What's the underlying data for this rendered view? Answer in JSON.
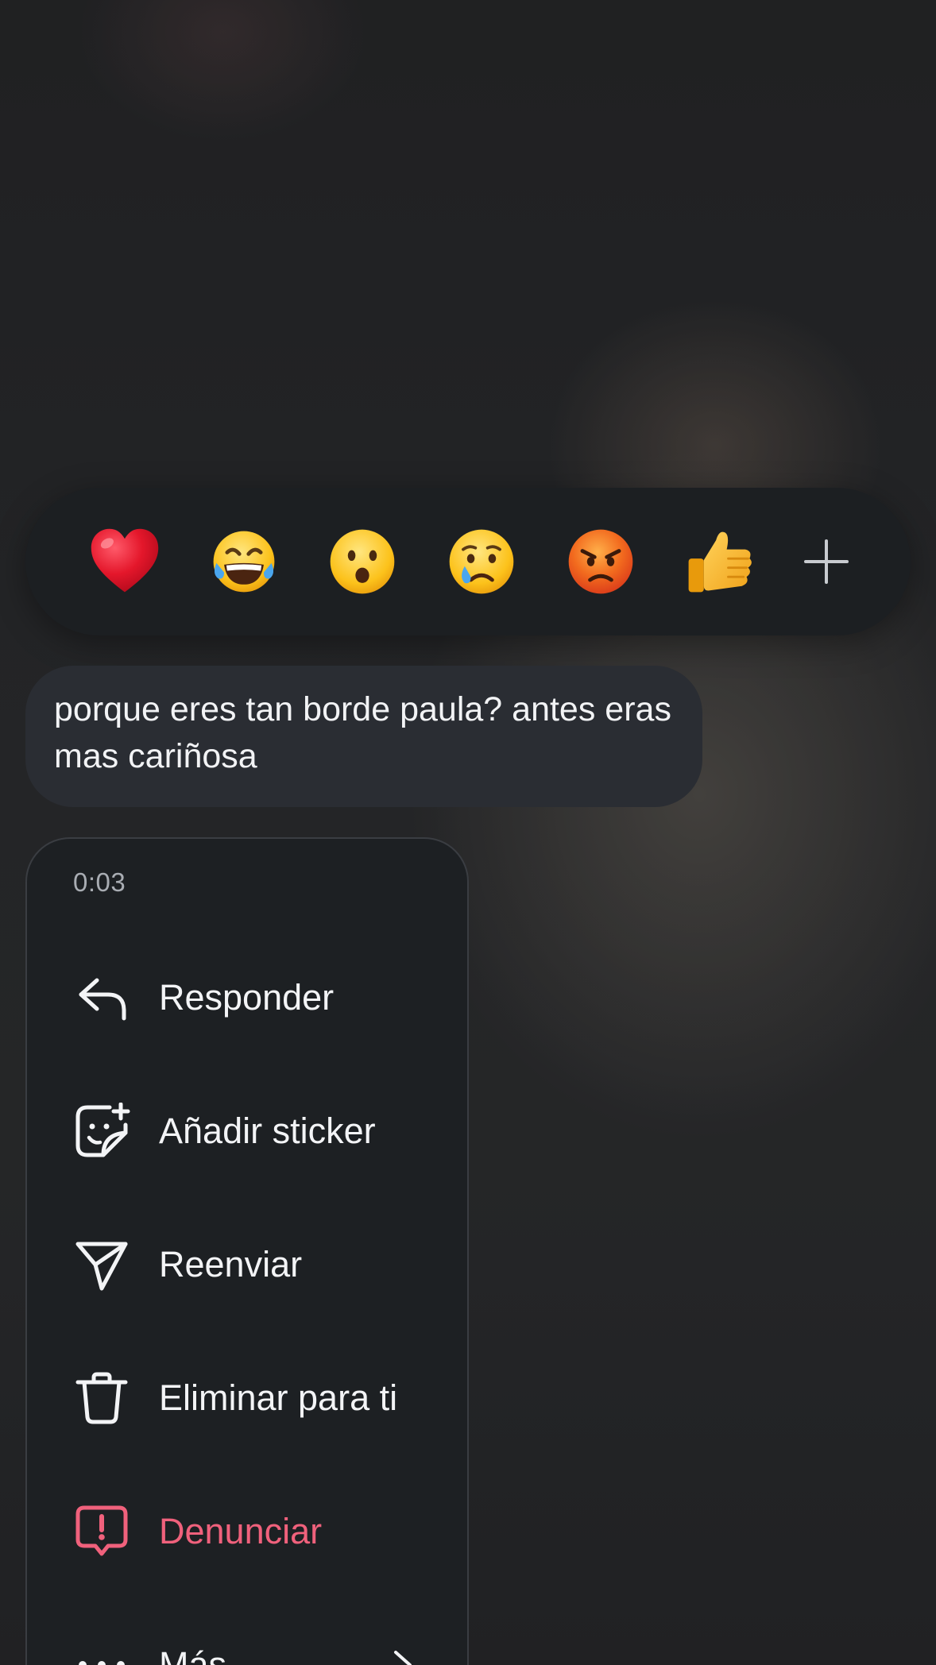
{
  "reactions": {
    "emojis": [
      "red-heart",
      "tears-of-joy",
      "hushed-face",
      "crying-face",
      "angry-face",
      "thumbs-up"
    ],
    "more_icon": "plus-icon"
  },
  "message": {
    "text": "porque eres tan borde paula? antes eras mas cariñosa"
  },
  "menu": {
    "time": "0:03",
    "items": [
      {
        "label": "Responder",
        "icon": "reply-arrow-icon"
      },
      {
        "label": "Añadir sticker",
        "icon": "add-sticker-icon"
      },
      {
        "label": "Reenviar",
        "icon": "send-paper-plane-icon"
      },
      {
        "label": "Eliminar para ti",
        "icon": "trash-icon"
      },
      {
        "label": "Denunciar",
        "icon": "report-alert-icon",
        "color": "#f0617c"
      },
      {
        "label": "Más",
        "icon": "more-dots-icon"
      }
    ]
  }
}
